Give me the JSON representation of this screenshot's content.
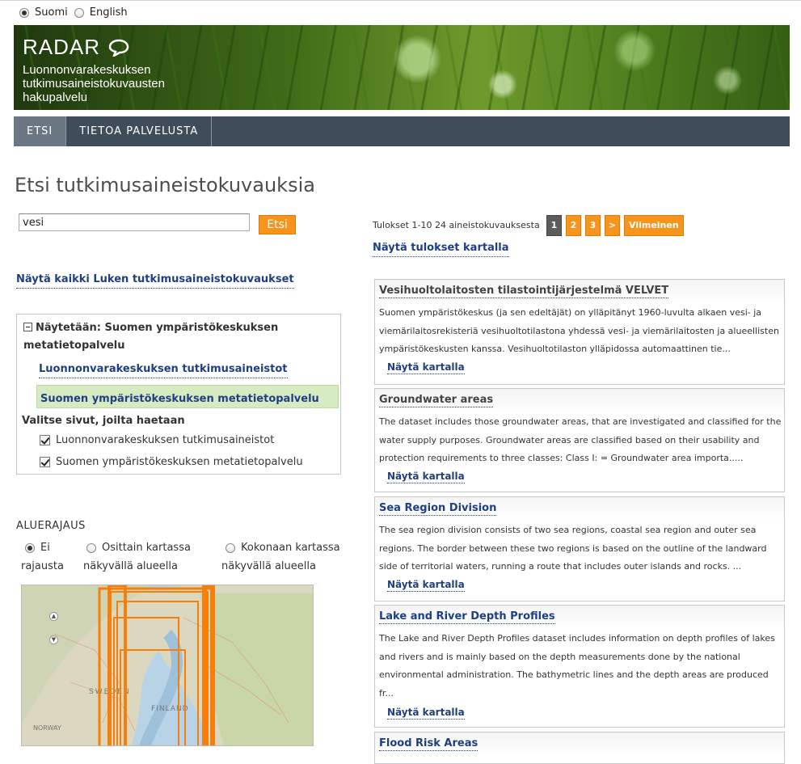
{
  "language": {
    "options": [
      "Suomi",
      "English"
    ],
    "selected": "Suomi"
  },
  "header": {
    "title": "RADAR",
    "subtitle": "Luonnonvarakeskuksen tutkimusaineistokuvausten hakupalvelu"
  },
  "nav": {
    "items": [
      "ETSI",
      "TIETOA PALVELUSTA"
    ],
    "active": "ETSI"
  },
  "page_title": "Etsi tutkimusaineistokuvauksia",
  "search": {
    "value": "vesi",
    "button": "Etsi"
  },
  "show_all_link": "Näytä kaikki Luken tutkimusaineistokuvaukset",
  "sources": {
    "showing": "Näytetään: Suomen ympäristökeskuksen metatietopalvelu",
    "items": [
      "Luonnonvarakeskuksen tutkimusaineistot",
      "Suomen ympäristökeskuksen metatietopalvelu"
    ],
    "choose_label": "Valitse sivut, joilta haetaan",
    "checkboxes": [
      "Luonnonvarakeskuksen tutkimusaineistot",
      "Suomen ympäristökeskuksen metatietopalvelu"
    ]
  },
  "area": {
    "title": "ALUERAJAUS",
    "options": [
      {
        "line1": "Ei",
        "line2": "rajausta",
        "selected": true
      },
      {
        "line1": "Osittain kartassa",
        "line2": "näkyvällä alueella",
        "selected": false
      },
      {
        "line1": "Kokonaan kartassa",
        "line2": "näkyvällä alueella",
        "selected": false
      }
    ],
    "map_labels": {
      "sweden": "SWEDEN",
      "finland": "FINLAND",
      "norway": "NORWAY"
    }
  },
  "results": {
    "info": "Tulokset 1-10 24 aineistokuvauksesta",
    "pages": [
      "1",
      "2",
      "3",
      ">",
      "Viimeinen"
    ],
    "current_page": "1",
    "map_link": "Näytä tulokset kartalla",
    "map_link_item": "Näytä kartalla",
    "items": [
      {
        "title": "Vesihuoltolaitosten tilastointijärjestelmä VELVET",
        "description": "Suomen ympäristökeskus (ja sen edeltäjät) on ylläpitänyt 1960-luvulta alkaen vesi- ja viemärilaitosrekisteriä vesihuoltotilastona yhdessä vesi- ja viemärilaitosten ja alueellisten ympäristökeskusten kanssa. Vesihuoltotilaston ylläpidossa automaattinen tie..."
      },
      {
        "title": "Groundwater areas",
        "description": "The dataset includes those groundwater areas, that are investigated and classified for the water supply purposes. Groundwater areas are classified based on their usability and protection requirements to three classes: Class I: = Groundwater area importa....."
      },
      {
        "title": "Sea Region Division",
        "description": "The sea region division consists of two sea regions, coastal sea region and outer sea regions. The border between these two regions is based on the outline of the landward side of territorial waters, running a route that includes outer islands and rocks. ..."
      },
      {
        "title": "Lake and River Depth Profiles",
        "description": "The Lake and River Depth Profiles dataset includes information on depth profiles of lakes and rivers and is mainly based on the depth measurements done by the national environmental administration. The bathymetric lines and the depth areas are produced fr..."
      },
      {
        "title": "Flood Risk Areas",
        "description": ""
      }
    ]
  },
  "colors": {
    "accent": "#f7941d",
    "link": "#1f3f84",
    "nav": "#3f4c5a",
    "highlight": "#d6ebc2"
  }
}
